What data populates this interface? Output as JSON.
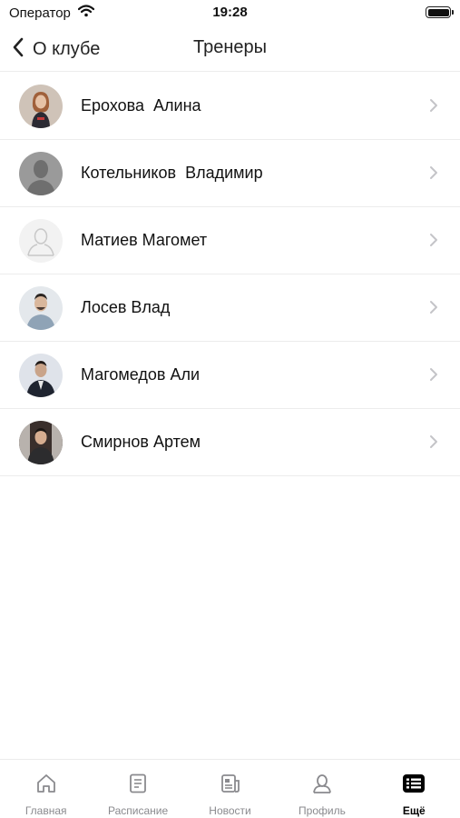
{
  "status_bar": {
    "carrier": "Оператор",
    "time": "19:28"
  },
  "nav": {
    "back_label": "О клубе",
    "title": "Тренеры"
  },
  "coaches": [
    {
      "name": "Ерохова  Алина",
      "avatar": "photo"
    },
    {
      "name": "Котельников  Владимир",
      "avatar": "silhouette-gray"
    },
    {
      "name": "Матиев Магомет",
      "avatar": "placeholder-outline"
    },
    {
      "name": "Лосев Влад",
      "avatar": "photo"
    },
    {
      "name": "Магомедов Али",
      "avatar": "photo"
    },
    {
      "name": "Смирнов Артем",
      "avatar": "photo"
    }
  ],
  "tabs": [
    {
      "label": "Главная",
      "icon": "home-icon"
    },
    {
      "label": "Расписание",
      "icon": "schedule-icon"
    },
    {
      "label": "Новости",
      "icon": "news-icon"
    },
    {
      "label": "Профиль",
      "icon": "profile-icon"
    },
    {
      "label": "Ещё",
      "icon": "more-list-icon",
      "active": true
    }
  ],
  "colors": {
    "tab_inactive": "#8a8a8e",
    "tab_active": "#000000",
    "separator": "#ececec"
  }
}
